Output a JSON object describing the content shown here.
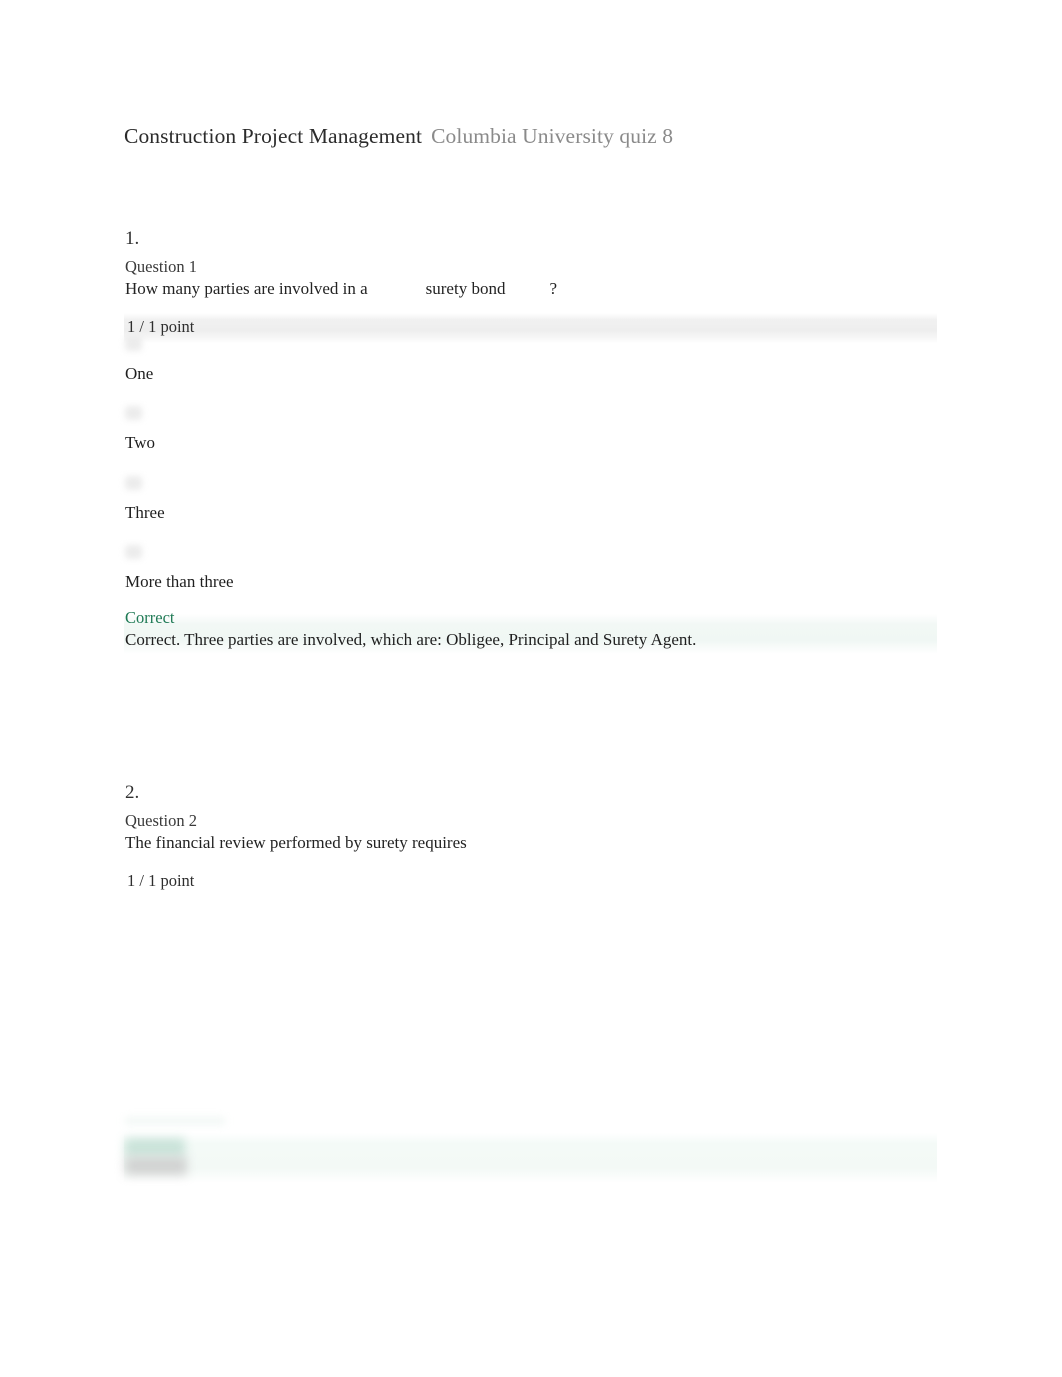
{
  "header": {
    "course_title": "Construction Project Management",
    "subtitle": "Columbia University quiz 8"
  },
  "questions": [
    {
      "index": "1.",
      "label": "Question 1",
      "text_before": "How many parties are involved in a",
      "term": "surety bond",
      "text_after": "?",
      "points": "1 / 1 point",
      "options": [
        {
          "label": "One"
        },
        {
          "label": "Two"
        },
        {
          "label": "Three"
        },
        {
          "label": "More than three"
        }
      ],
      "feedback": {
        "status": "Correct",
        "text": "Correct. Three parties are involved, which are: Obligee, Principal and Surety Agent."
      }
    },
    {
      "index": "2.",
      "label": "Question 2",
      "text_before": "The financial review performed by surety requires",
      "term": "",
      "text_after": "",
      "points": "1 / 1 point",
      "options": [],
      "feedback": {
        "status": "",
        "text": ""
      }
    }
  ],
  "colors": {
    "correct_green": "#1f7a55",
    "title_dark": "#2b2b2b",
    "subtitle_gray": "#8a8a8a",
    "body_text": "#1f1f1f",
    "points_band": "#eeeeee",
    "feedback_bg": "#f2f8f5"
  }
}
